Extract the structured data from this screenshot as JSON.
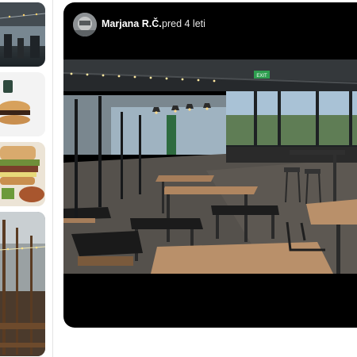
{
  "review": {
    "author_name": "Marjana R.Č.",
    "separator": "·",
    "time_ago": "pred 4 leti"
  },
  "photo": {
    "exit_sign_text": "EXIT"
  },
  "colors": {
    "card_background": "#000000",
    "page_background": "#ffffff",
    "floor": "#54504b",
    "table_wood": "#b08660",
    "bench_pad": "#1b1b1b"
  },
  "icons": [
    "avatar-photo"
  ]
}
